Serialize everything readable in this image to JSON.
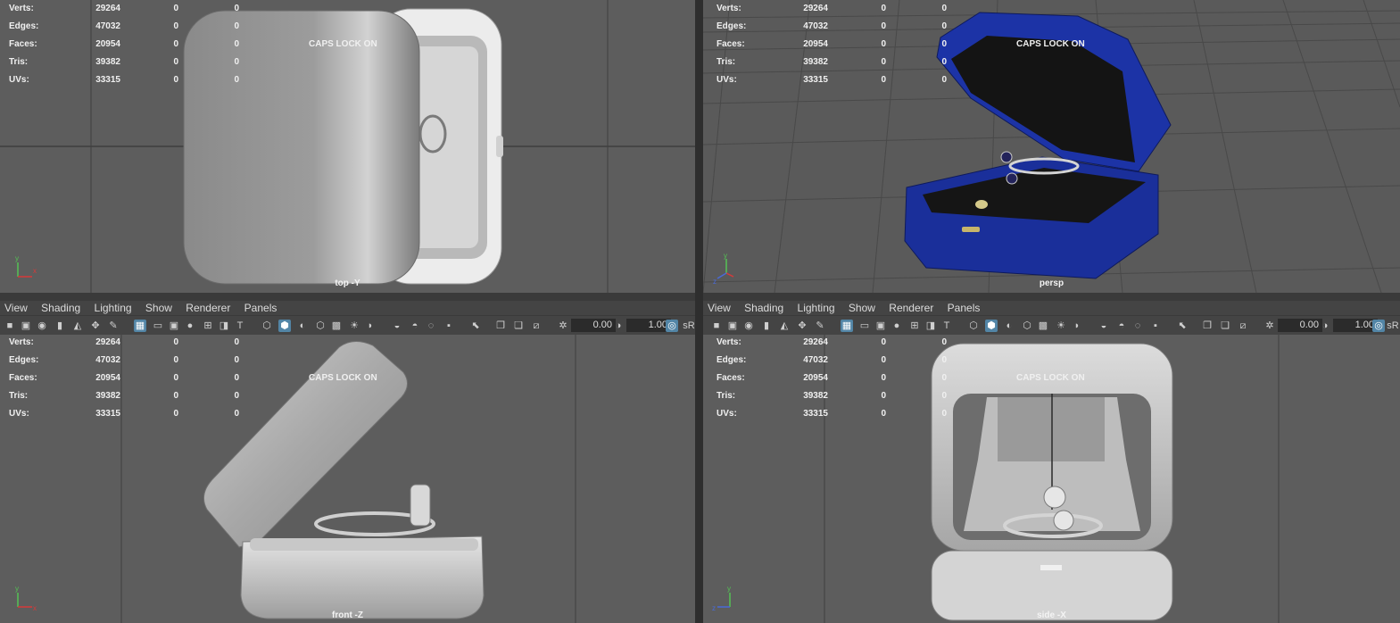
{
  "hud": {
    "rows": [
      {
        "label": "Verts:",
        "v0": "29264",
        "v1": "0",
        "v2": "0"
      },
      {
        "label": "Edges:",
        "v0": "47032",
        "v1": "0",
        "v2": "0"
      },
      {
        "label": "Faces:",
        "v0": "20954",
        "v1": "0",
        "v2": "0"
      },
      {
        "label": "Tris:",
        "v0": "39382",
        "v1": "0",
        "v2": "0"
      },
      {
        "label": "UVs:",
        "v0": "33315",
        "v1": "0",
        "v2": "0"
      }
    ]
  },
  "caps_lock": "CAPS LOCK ON",
  "cameras": {
    "top": "top -Y",
    "persp": "persp",
    "front": "front -Z",
    "side": "side -X"
  },
  "menu": {
    "items": [
      "View",
      "Shading",
      "Lighting",
      "Show",
      "Renderer",
      "Panels"
    ]
  },
  "toolbar": {
    "value_a": "0.00",
    "value_b": "1.00",
    "srgb": "sR"
  },
  "axes": {
    "x": "x",
    "y": "y",
    "z": "z"
  },
  "colors": {
    "viewport": "#5d5d5d",
    "box_blue": "#1a2f9a",
    "selected_icon": "#5285a6"
  }
}
